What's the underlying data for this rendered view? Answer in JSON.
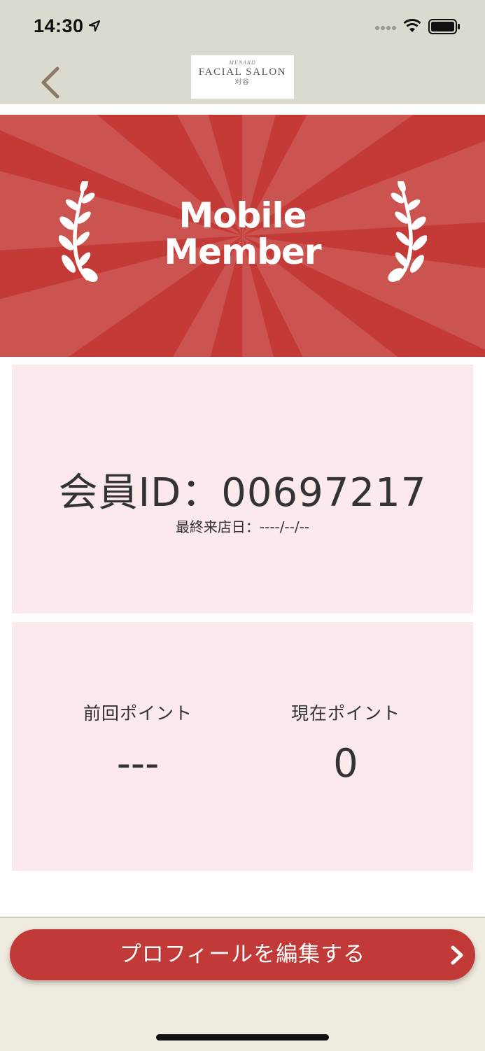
{
  "status_bar": {
    "time": "14:30",
    "icons": [
      "location-arrow-icon",
      "signal-dots-icon",
      "wifi-icon",
      "battery-icon"
    ]
  },
  "nav": {
    "back_icon": "chevron-left-icon",
    "logo": {
      "brand": "MENARD",
      "title": "FACIAL SALON",
      "subtitle": "刈谷"
    }
  },
  "hero": {
    "title_line1": "Mobile",
    "title_line2": "Member",
    "icons": [
      "laurel-left-icon",
      "laurel-right-icon"
    ],
    "color": "#c43a37"
  },
  "member": {
    "id_text": "会員ID：00697217",
    "last_visit": "最終来店日：----/--/--"
  },
  "points": {
    "previous_label": "前回ポイント",
    "previous_value": "---",
    "current_label": "現在ポイント",
    "current_value": "0"
  },
  "footer": {
    "edit_button_label": "プロフィールを編集する",
    "button_icon": "chevron-right-icon",
    "button_color": "#c23a37"
  },
  "colors": {
    "nav_bg": "#dcdace",
    "card_bg": "#fbe9ec",
    "footer_bg": "#f0ebdf"
  }
}
